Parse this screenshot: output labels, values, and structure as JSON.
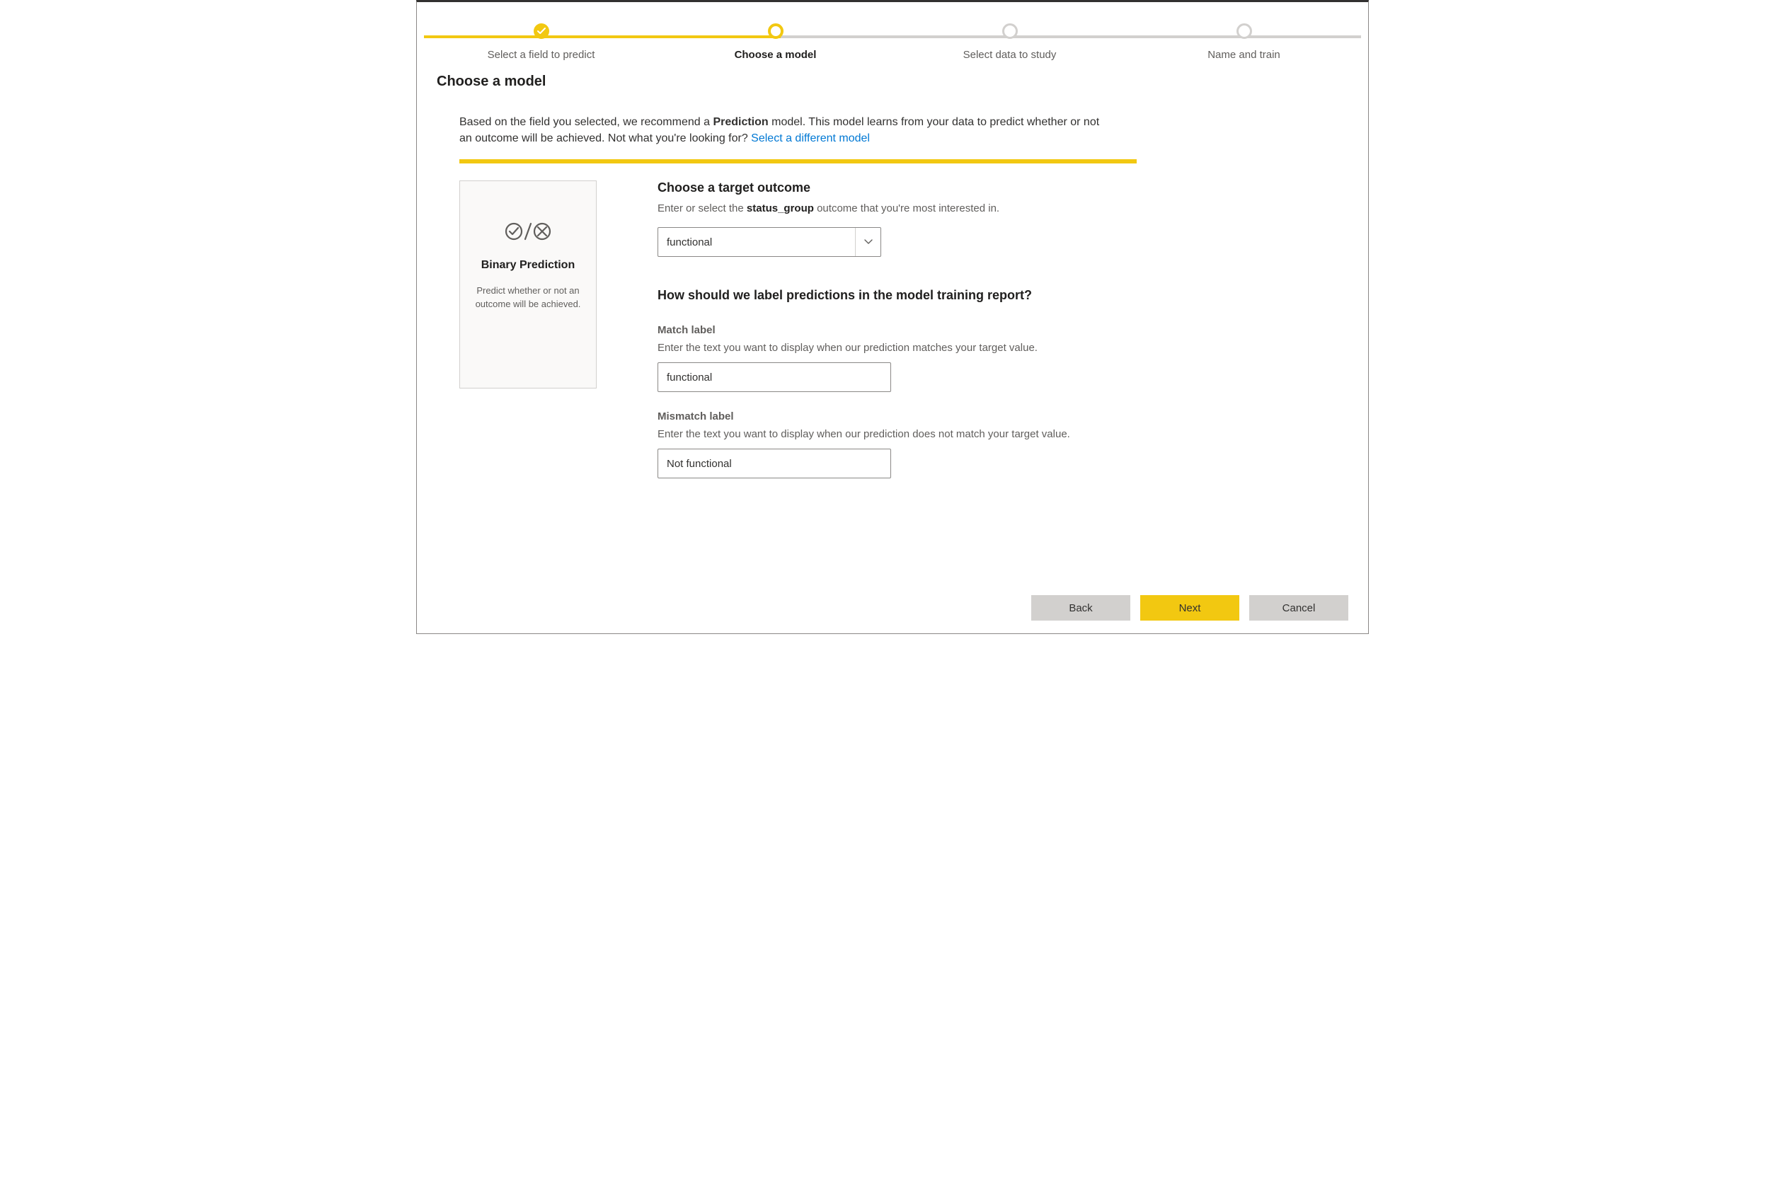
{
  "stepper": {
    "steps": [
      {
        "label": "Select a field to predict",
        "state": "completed"
      },
      {
        "label": "Choose a model",
        "state": "current"
      },
      {
        "label": "Select data to study",
        "state": "upcoming"
      },
      {
        "label": "Name and train",
        "state": "upcoming"
      }
    ]
  },
  "page_title": "Choose a model",
  "intro": {
    "prefix": "Based on the field you selected, we recommend a ",
    "model_word": "Prediction",
    "mid": " model. This model learns from your data to predict whether or not an outcome will be achieved. Not what you're looking for? ",
    "link": "Select a different model"
  },
  "model_card": {
    "title": "Binary Prediction",
    "desc": "Predict whether or not an outcome will be achieved."
  },
  "target": {
    "heading": "Choose a target outcome",
    "sub_prefix": "Enter or select the ",
    "field_name": "status_group",
    "sub_suffix": " outcome that you're most interested in.",
    "value": "functional"
  },
  "labels": {
    "heading": "How should we label predictions in the model training report?",
    "match_label_title": "Match label",
    "match_label_help": "Enter the text you want to display when our prediction matches your target value.",
    "match_value": "functional",
    "mismatch_label_title": "Mismatch label",
    "mismatch_label_help": "Enter the text you want to display when our prediction does not match your target value.",
    "mismatch_value": "Not functional"
  },
  "footer": {
    "back": "Back",
    "next": "Next",
    "cancel": "Cancel"
  },
  "colors": {
    "accent": "#f2c811",
    "link": "#0078d4"
  }
}
